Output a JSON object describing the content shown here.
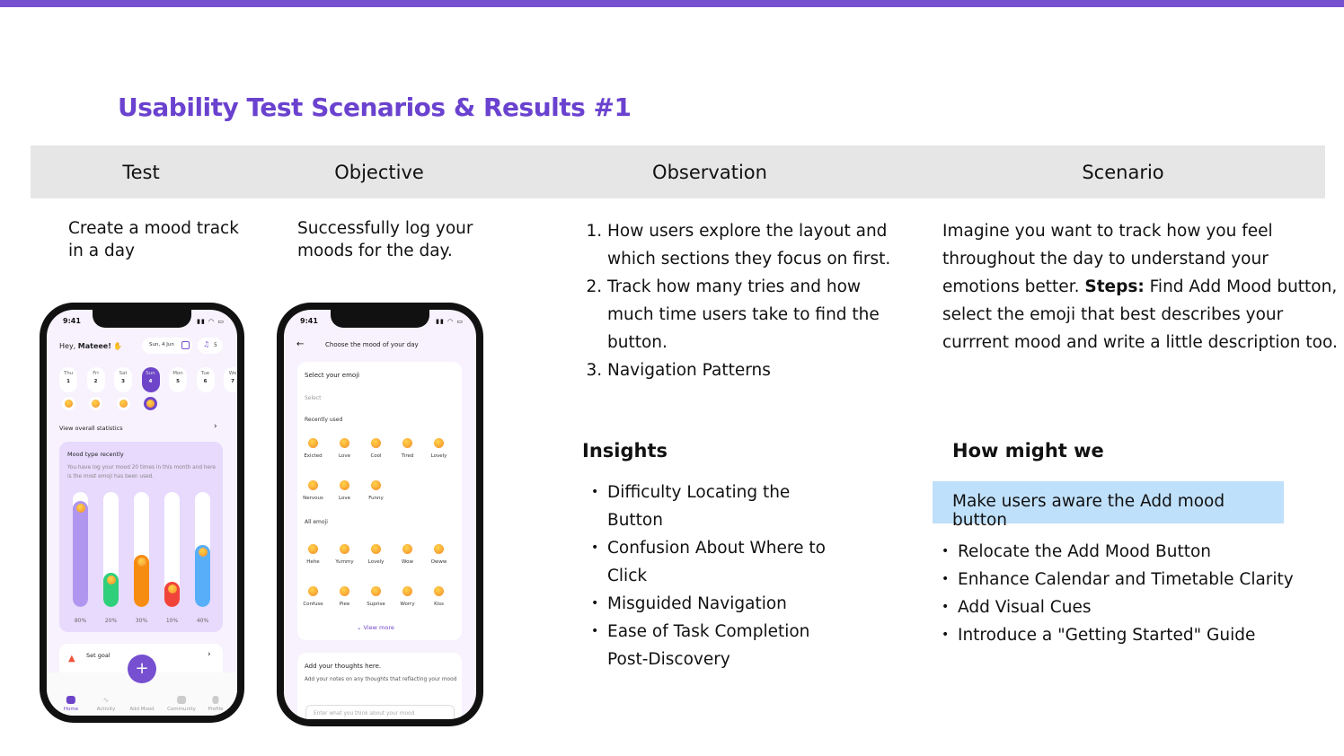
{
  "title": "Usability Test Scenarios & Results #1",
  "colors": {
    "accent": "#6a42cf",
    "header_bg": "#e6e6e6",
    "highlight": "#bfe0fb"
  },
  "table": {
    "headers": [
      "Test",
      "Objective",
      "Observation",
      "Scenario"
    ],
    "test": "Create a mood track in a day",
    "objective": "Successfully log your moods for the day.",
    "observation": [
      "How users explore the layout and which sections they focus on first.",
      "Track how many tries and how much time users take to find the button.",
      "Navigation Patterns"
    ],
    "scenario_intro": "Imagine you want to track how you feel throughout the day to understand your emotions better.",
    "scenario_steps_label": "Steps:",
    "scenario_steps": " Find Add Mood button, select the emoji that best describes your currrent mood and write a little description too."
  },
  "insights": {
    "heading": "Insights",
    "items": [
      "Difficulty Locating the Button",
      "Confusion About Where to Click",
      "Misguided Navigation",
      "Ease of Task Completion Post-Discovery"
    ]
  },
  "hmw": {
    "heading": "How might we",
    "highlight": "Make users aware the Add mood button",
    "items": [
      "Relocate the Add Mood Button",
      "Enhance Calendar and Timetable Clarity",
      "Add Visual Cues",
      "Introduce a \"Getting Started\" Guide"
    ]
  },
  "phone1": {
    "time": "9:41",
    "greeting": "Hey, ",
    "name": "Mateee!",
    "date": "Sun, 4 Jun",
    "notifications": "5",
    "days": [
      {
        "d": "Thu",
        "n": "1"
      },
      {
        "d": "Fri",
        "n": "2"
      },
      {
        "d": "Sat",
        "n": "3"
      },
      {
        "d": "Sun",
        "n": "4"
      },
      {
        "d": "Mon",
        "n": "5"
      },
      {
        "d": "Tue",
        "n": "6"
      },
      {
        "d": "We",
        "n": "7"
      }
    ],
    "stats_link": "View overall statistics",
    "mood_title": "Mood type recently",
    "mood_desc": "You have log your mood 20 times in this month and here is the most emoji has been used.",
    "bars": [
      {
        "pct": 80,
        "label": "80%",
        "color": "#b196ef"
      },
      {
        "pct": 20,
        "label": "20%",
        "color": "#2fcf7c"
      },
      {
        "pct": 30,
        "label": "30%",
        "color": "#f78c12"
      },
      {
        "pct": 10,
        "label": "10%",
        "color": "#f0433a"
      },
      {
        "pct": 40,
        "label": "40%",
        "color": "#58aef8"
      }
    ],
    "goal": "Set goal",
    "nav": [
      "Home",
      "Activity",
      "Add Mood",
      "Community",
      "Profile"
    ]
  },
  "phone2": {
    "time": "9:41",
    "header": "Choose the mood of your day",
    "select_title": "Select your emoji",
    "select_placeholder": "Select",
    "recent_label": "Recently used",
    "recent": [
      "Exicted",
      "Love",
      "Cool",
      "Tired",
      "Lovely",
      "Nervous",
      "Love",
      "Funny"
    ],
    "all_label": "All emoji",
    "all": [
      "Hehe",
      "Yummy",
      "Lovely",
      "Wow",
      "Owww",
      "Confuse",
      "Piee",
      "Suprise",
      "Worry",
      "Kiss"
    ],
    "view_more": "View more",
    "thoughts_title": "Add your thoughts here.",
    "thoughts_desc": "Add your notes on any thoughts that reflacting your mood",
    "thoughts_placeholder": "Enter what you think about your mood"
  }
}
